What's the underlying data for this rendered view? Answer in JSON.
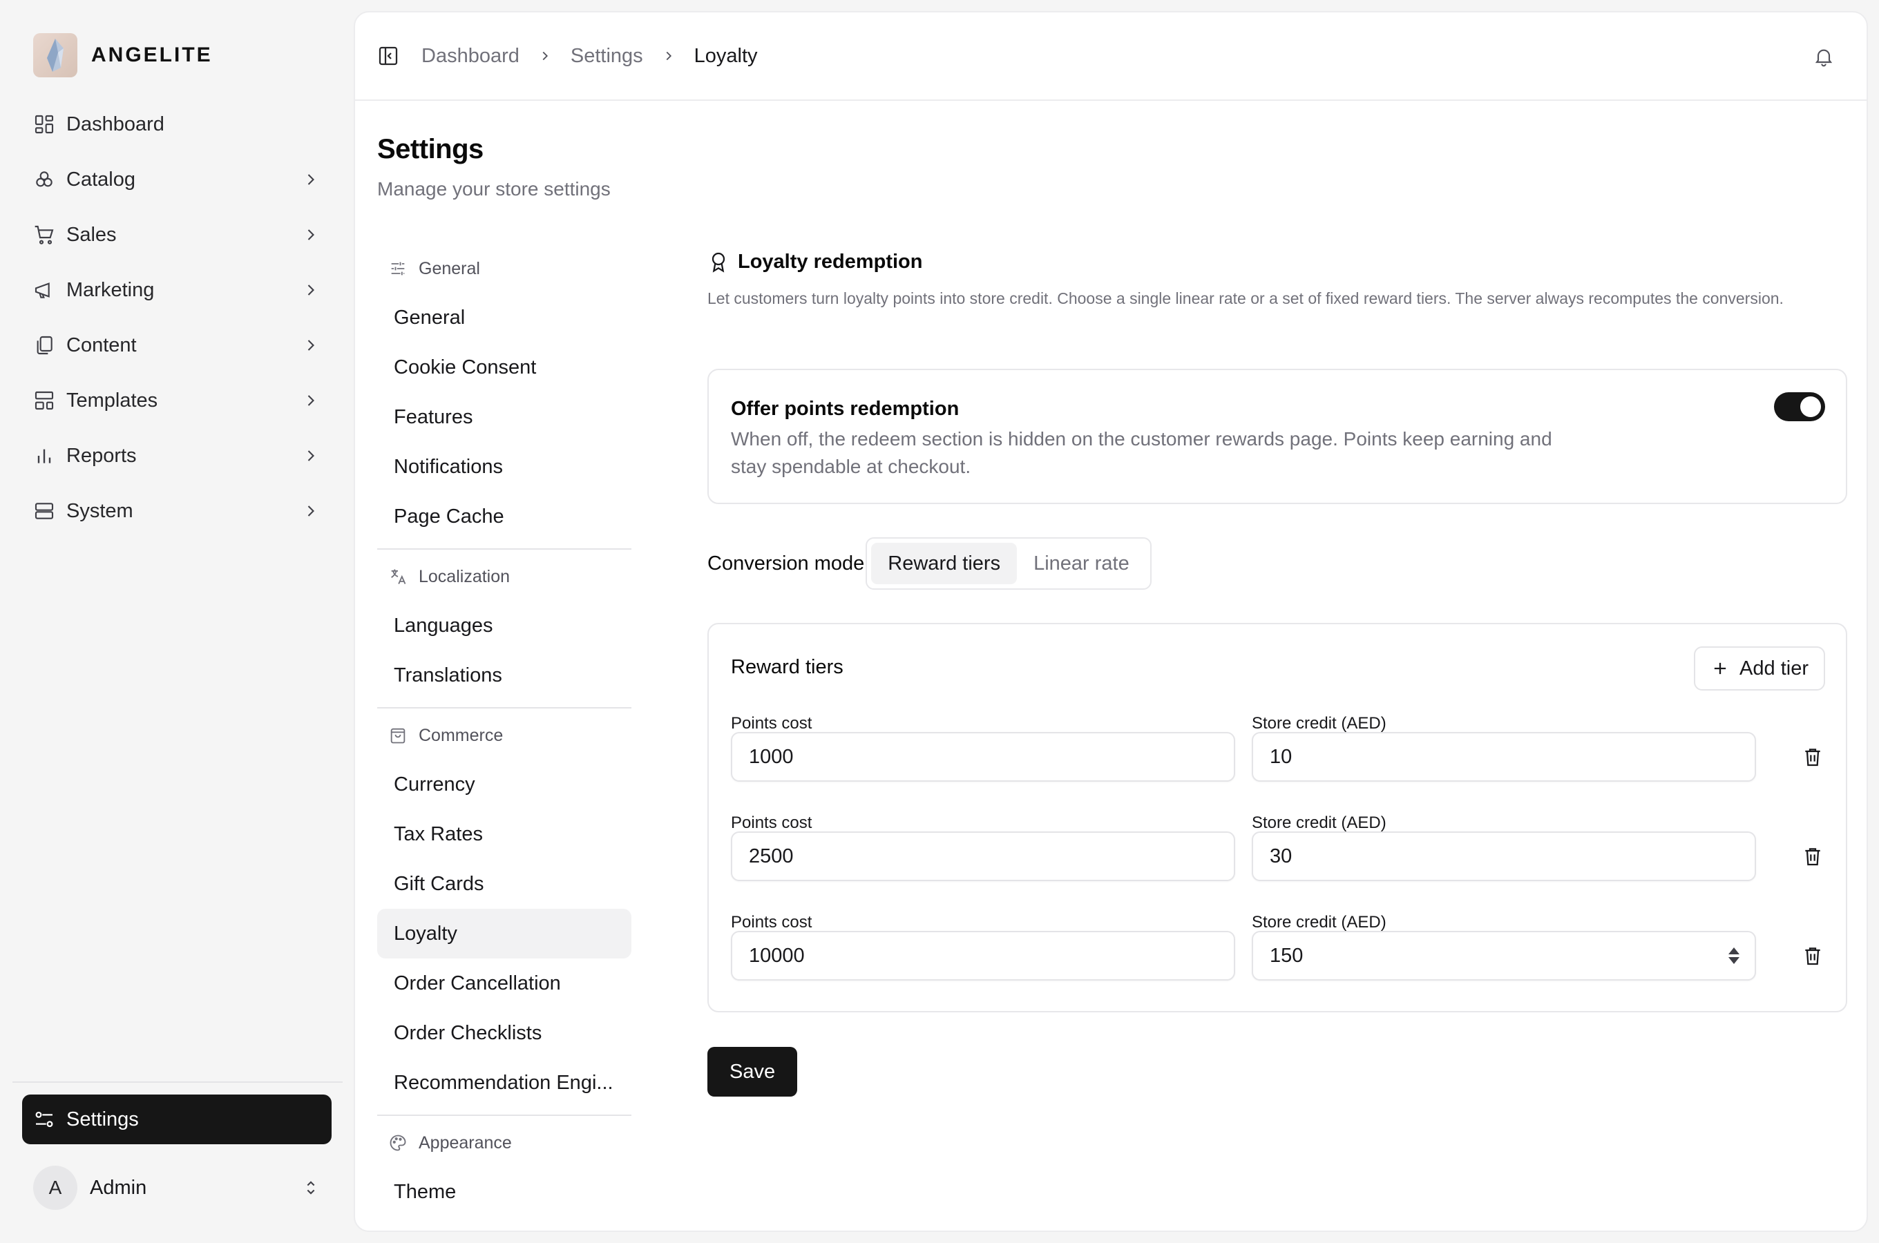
{
  "brand": {
    "name": "ANGELITE",
    "logo_icon": "crystal-logo"
  },
  "sidebar": {
    "items": [
      {
        "label": "Dashboard",
        "icon": "dashboard-icon",
        "has_chevron": false
      },
      {
        "label": "Catalog",
        "icon": "catalog-icon",
        "has_chevron": true
      },
      {
        "label": "Sales",
        "icon": "cart-icon",
        "has_chevron": true
      },
      {
        "label": "Marketing",
        "icon": "megaphone-icon",
        "has_chevron": true
      },
      {
        "label": "Content",
        "icon": "copy-icon",
        "has_chevron": true
      },
      {
        "label": "Templates",
        "icon": "layout-icon",
        "has_chevron": true
      },
      {
        "label": "Reports",
        "icon": "bar-chart-icon",
        "has_chevron": true
      },
      {
        "label": "System",
        "icon": "server-icon",
        "has_chevron": true
      }
    ],
    "settings_label": "Settings",
    "user": {
      "initial": "A",
      "name": "Admin"
    }
  },
  "topbar": {
    "breadcrumbs": [
      "Dashboard",
      "Settings",
      "Loyalty"
    ]
  },
  "page": {
    "title": "Settings",
    "subtitle": "Manage your store settings"
  },
  "subnav": {
    "groups": [
      {
        "label": "General",
        "icon": "sliders-icon",
        "items": [
          "General",
          "Cookie Consent",
          "Features",
          "Notifications",
          "Page Cache"
        ]
      },
      {
        "label": "Localization",
        "icon": "translate-icon",
        "items": [
          "Languages",
          "Translations"
        ]
      },
      {
        "label": "Commerce",
        "icon": "shopping-bag-icon",
        "items": [
          "Currency",
          "Tax Rates",
          "Gift Cards",
          "Loyalty",
          "Order Cancellation",
          "Order Checklists",
          "Recommendation Engi..."
        ]
      },
      {
        "label": "Appearance",
        "icon": "palette-icon",
        "items": [
          "Theme"
        ]
      }
    ],
    "active": "Loyalty"
  },
  "section": {
    "title": "Loyalty redemption",
    "icon": "award-icon",
    "description": "Let customers turn loyalty points into store credit. Choose a single linear rate or a set of fixed reward tiers. The server always recomputes the conversion."
  },
  "toggle_card": {
    "title": "Offer points redemption",
    "description": "When off, the redeem section is hidden on the customer rewards page. Points keep earning and stay spendable at checkout.",
    "enabled": true
  },
  "conversion": {
    "label": "Conversion mode",
    "options": [
      "Reward tiers",
      "Linear rate"
    ],
    "selected": "Reward tiers"
  },
  "tiers": {
    "title": "Reward tiers",
    "add_label": "Add tier",
    "points_label": "Points cost",
    "credit_label": "Store credit (AED)",
    "rows": [
      {
        "points": "1000",
        "credit": "10"
      },
      {
        "points": "2500",
        "credit": "30"
      },
      {
        "points": "10000",
        "credit": "150"
      }
    ]
  },
  "save_label": "Save",
  "colors": {
    "accent": "#161616",
    "muted_text": "#71717a",
    "border": "#e7e7ea"
  }
}
